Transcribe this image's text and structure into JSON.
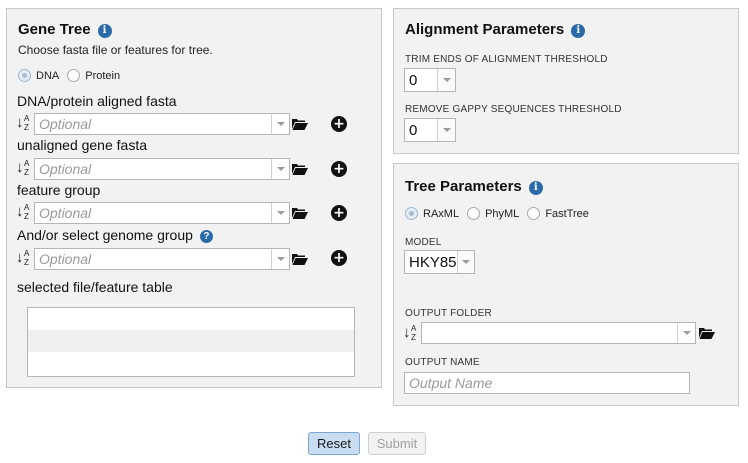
{
  "gene_tree": {
    "title": "Gene Tree",
    "description": "Choose fasta file or features for tree.",
    "seq_type_options": [
      "DNA",
      "Protein"
    ],
    "seq_type_selected": "DNA",
    "fields": [
      {
        "label": "DNA/protein aligned fasta",
        "placeholder": "Optional"
      },
      {
        "label": "unaligned gene fasta",
        "placeholder": "Optional"
      },
      {
        "label": "feature group",
        "placeholder": "Optional"
      },
      {
        "label": "And/or select genome group",
        "placeholder": "Optional"
      }
    ],
    "table_label": "selected file/feature table"
  },
  "alignment": {
    "title": "Alignment Parameters",
    "trim_label": "TRIM ENDS OF ALIGNMENT THRESHOLD",
    "trim_value": "0",
    "gappy_label": "REMOVE GAPPY SEQUENCES THRESHOLD",
    "gappy_value": "0"
  },
  "tree": {
    "title": "Tree Parameters",
    "method_options": [
      "RAxML",
      "PhyML",
      "FastTree"
    ],
    "method_selected": "RAxML",
    "model_label": "MODEL",
    "model_value": "HKY85",
    "output_folder_label": "OUTPUT FOLDER",
    "output_folder_value": "",
    "output_name_label": "OUTPUT NAME",
    "output_name_placeholder": "Output Name"
  },
  "buttons": {
    "reset": "Reset",
    "submit": "Submit"
  },
  "icons": {
    "info": "info-icon",
    "help": "help-icon",
    "sort": "sort-az-icon",
    "folder": "folder-open-icon",
    "add": "plus-circle-icon"
  },
  "colors": {
    "accent": "#2b6aa8",
    "reset_bg": "#c8dcf2"
  }
}
